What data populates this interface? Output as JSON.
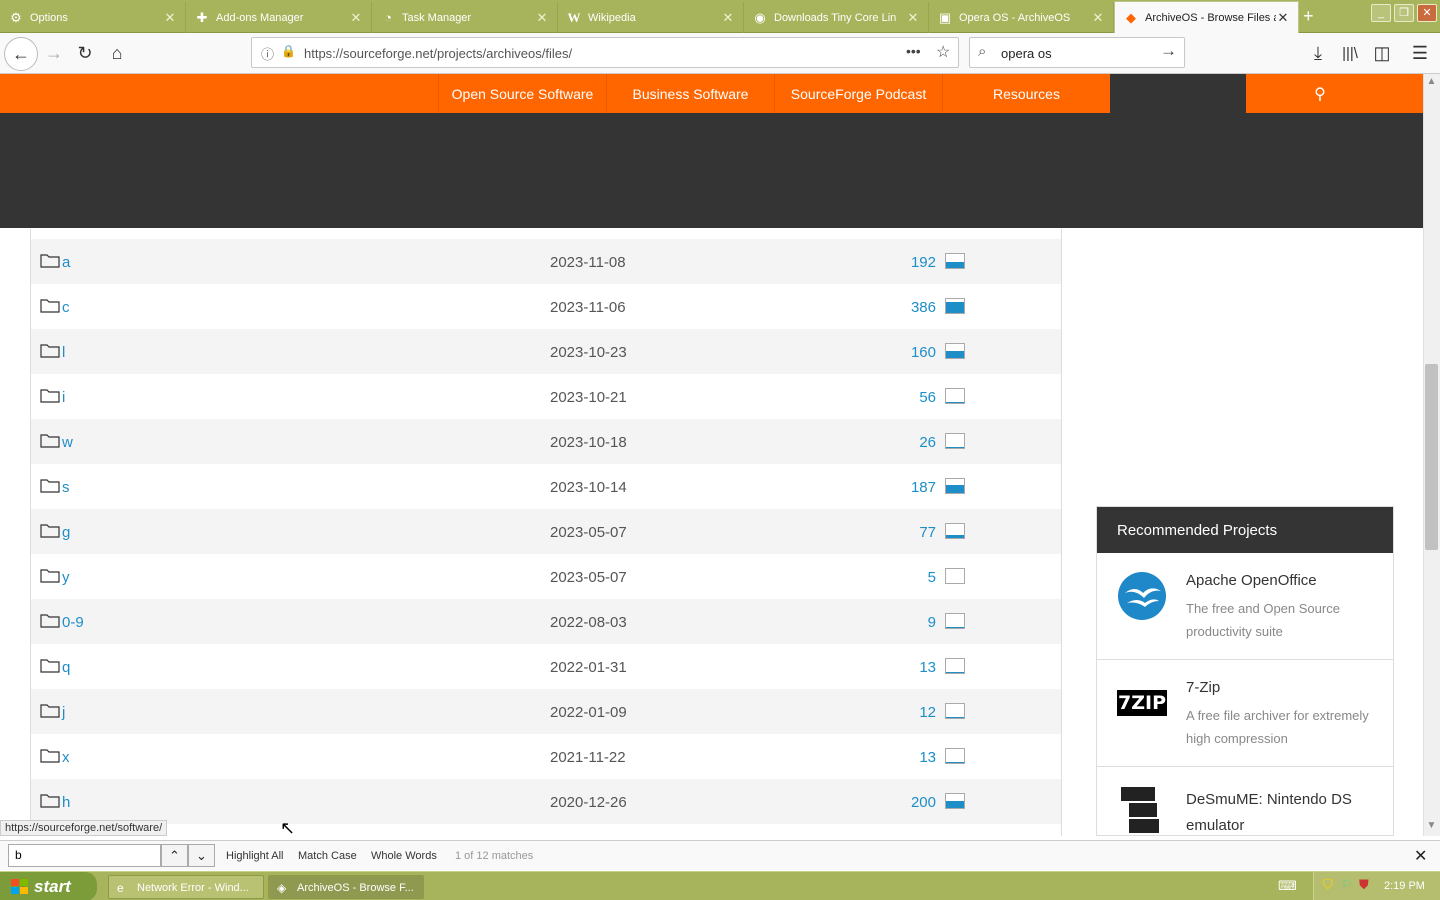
{
  "browser": {
    "tabs": [
      {
        "label": "Options",
        "icon": "gear-icon",
        "active": false
      },
      {
        "label": "Add-ons Manager",
        "icon": "puzzle-icon",
        "active": false
      },
      {
        "label": "Task Manager",
        "icon": "gauge-icon",
        "active": false
      },
      {
        "label": "Wikipedia",
        "icon": "wikipedia-icon",
        "active": false
      },
      {
        "label": "Downloads Tiny Core Lin",
        "icon": "tinycore-icon",
        "active": false
      },
      {
        "label": "Opera OS - ArchiveOS",
        "icon": "monitor-icon",
        "active": false
      },
      {
        "label": "ArchiveOS - Browse Files a",
        "icon": "sourceforge-icon",
        "active": true
      }
    ],
    "url": "https://sourceforge.net/projects/archiveos/files/",
    "search_value": "opera os",
    "status_url": "https://sourceforge.net/software/"
  },
  "site_nav": {
    "items": [
      "Open Source Software",
      "Business Software",
      "SourceForge Podcast",
      "Resources"
    ]
  },
  "files": [
    {
      "name": "a",
      "date": "2023-11-08",
      "count": "192",
      "activity": 0.45
    },
    {
      "name": "c",
      "date": "2023-11-06",
      "count": "386",
      "activity": 0.8
    },
    {
      "name": "l",
      "date": "2023-10-23",
      "count": "160",
      "activity": 0.5
    },
    {
      "name": "i",
      "date": "2023-10-21",
      "count": "56",
      "activity": 0.1
    },
    {
      "name": "w",
      "date": "2023-10-18",
      "count": "26",
      "activity": 0.08
    },
    {
      "name": "s",
      "date": "2023-10-14",
      "count": "187",
      "activity": 0.55
    },
    {
      "name": "g",
      "date": "2023-05-07",
      "count": "77",
      "activity": 0.2
    },
    {
      "name": "y",
      "date": "2023-05-07",
      "count": "5",
      "activity": 0.0
    },
    {
      "name": "0-9",
      "date": "2022-08-03",
      "count": "9",
      "activity": 0.05
    },
    {
      "name": "q",
      "date": "2022-01-31",
      "count": "13",
      "activity": 0.06
    },
    {
      "name": "j",
      "date": "2022-01-09",
      "count": "12",
      "activity": 0.05
    },
    {
      "name": "x",
      "date": "2021-11-22",
      "count": "13",
      "activity": 0.06
    },
    {
      "name": "h",
      "date": "2020-12-26",
      "count": "200",
      "activity": 0.5
    }
  ],
  "recommended": {
    "title": "Recommended Projects",
    "projects": [
      {
        "name": "Apache OpenOffice",
        "desc": "The free and Open Source productivity suite",
        "logo": "openoffice-logo"
      },
      {
        "name": "7-Zip",
        "desc": "A free file archiver for extremely high compression",
        "logo": "7zip-logo",
        "logo_text": "7ZIP"
      },
      {
        "name": "DeSmuME: Nintendo DS emulator",
        "desc": "",
        "logo": "desmume-logo"
      }
    ]
  },
  "findbar": {
    "value": "b",
    "highlight_all": "Highlight All",
    "match_case": "Match Case",
    "whole_words": "Whole Words",
    "matches": "1 of 12 matches"
  },
  "taskbar": {
    "start": "start",
    "tasks": [
      {
        "label": "Network Error - Wind...",
        "active": false
      },
      {
        "label": "ArchiveOS - Browse F...",
        "active": true
      }
    ],
    "clock": "2:19 PM"
  }
}
